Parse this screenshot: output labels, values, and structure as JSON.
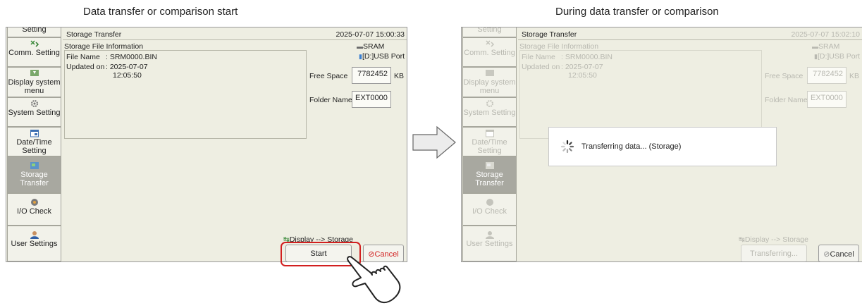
{
  "captions": {
    "left": "Data transfer or comparison start",
    "right": "During data transfer or comparison"
  },
  "colors": {
    "screen_bg": "#eeeee2",
    "active_tab": "#a8a8a0",
    "highlight": "#d21f1f",
    "cancel_text": "#d21f1f"
  },
  "sidebar": {
    "items": [
      {
        "label": "Setting",
        "icon": "wrench-icon"
      },
      {
        "label": "Comm. Setting",
        "icon": "comm-icon"
      },
      {
        "label": "Display system menu",
        "icon": "display-icon"
      },
      {
        "label": "System Setting",
        "icon": "gear-icon"
      },
      {
        "label": "Date/Time Setting",
        "icon": "calendar-icon"
      },
      {
        "label": "Storage Transfer",
        "icon": "storage-icon"
      },
      {
        "label": "I/O Check",
        "icon": "io-icon"
      },
      {
        "label": "User Settings",
        "icon": "user-icon"
      }
    ]
  },
  "left_screen": {
    "title": "Storage Transfer",
    "datetime": "2025-07-07 15:00:33",
    "section_label": "Storage File Information",
    "storage_primary": "SRAM",
    "storage_secondary": "[D:]USB Port",
    "file_name_label": "File Name",
    "file_name_value": ": SRM0000.BIN",
    "updated_label": "Updated on",
    "updated_date": ": 2025-07-07",
    "updated_time": "12:05:50",
    "free_space_label": "Free Space",
    "free_space_value": "7782452",
    "free_space_unit": "KB",
    "folder_name_label": "Folder Name",
    "folder_name_value": "EXT0000",
    "direction_label": "Display --> Storage",
    "start_button": "Start",
    "cancel_button": "Cancel"
  },
  "right_screen": {
    "title": "Storage Transfer",
    "datetime": "2025-07-07 15:02:10",
    "section_label": "Storage File Information",
    "storage_primary": "SRAM",
    "storage_secondary": "[D:]USB Port",
    "file_name_label": "File Name",
    "file_name_value": ": SRM0000.BIN",
    "updated_label": "Updated on",
    "updated_date": ": 2025-07-07",
    "updated_time": "12:05:50",
    "free_space_label": "Free Space",
    "free_space_value": "7782452",
    "free_space_unit": "KB",
    "folder_name_label": "Folder Name",
    "folder_name_value": "EXT0000",
    "direction_label": "Display --> Storage",
    "transferring_button": "Transferring...",
    "cancel_button": "Cancel",
    "progress_message": "Transferring data... (Storage)"
  }
}
